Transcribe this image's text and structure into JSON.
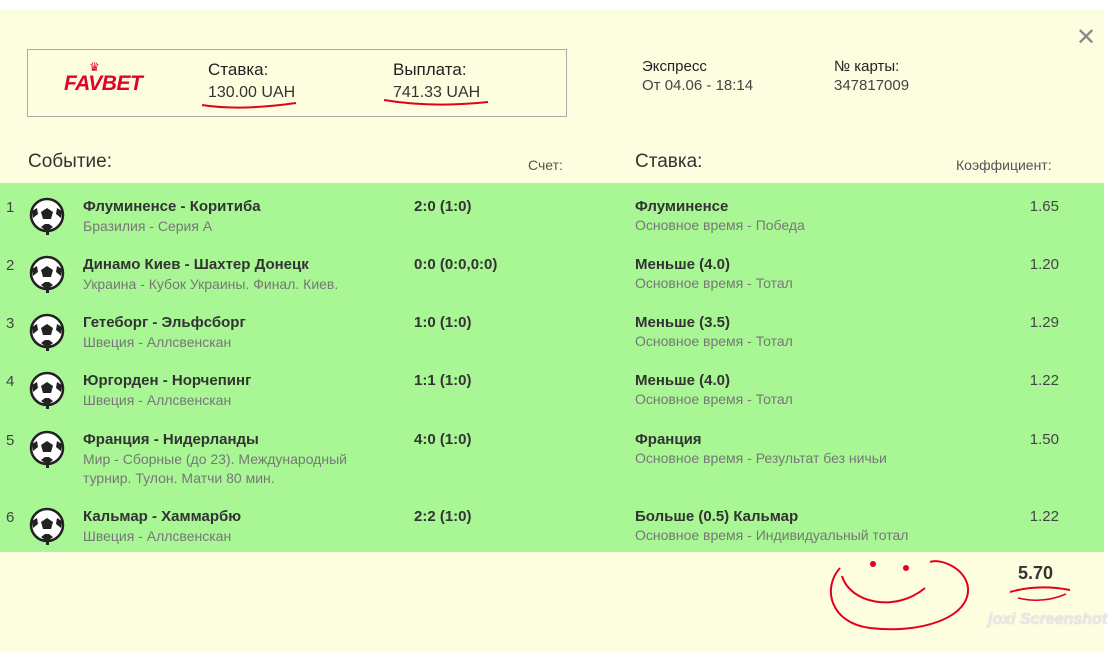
{
  "logo_text": "FAVBET",
  "summary": {
    "stake_label": "Ставка:",
    "stake_value": "130.00 UAH",
    "payout_label": "Выплата:",
    "payout_value": "741.33 UAH"
  },
  "info": {
    "type_label": "Экспресс",
    "date_text": "От 04.06 - 18:14",
    "card_label": "№ карты:",
    "card_number": "347817009"
  },
  "headers": {
    "event": "Событие:",
    "score": "Счет:",
    "bet": "Ставка:",
    "coef": "Коэффициент:"
  },
  "rows": [
    {
      "num": "1",
      "event": "Флуминенсе - Коритиба",
      "league": "Бразилия - Серия А",
      "score": "2:0 (1:0)",
      "bet": "Флуминенсе",
      "market": "Основное время - Победа",
      "coef": "1.65"
    },
    {
      "num": "2",
      "event": "Динамо Киев - Шахтер Донецк",
      "league": "Украина - Кубок Украины. Финал. Киев.",
      "score": "0:0 (0:0,0:0)",
      "bet": "Меньше (4.0)",
      "market": "Основное время - Тотал",
      "coef": "1.20"
    },
    {
      "num": "3",
      "event": "Гетеборг - Эльфсборг",
      "league": "Швеция - Аллсвенскан",
      "score": "1:0 (1:0)",
      "bet": "Меньше (3.5)",
      "market": "Основное время - Тотал",
      "coef": "1.29"
    },
    {
      "num": "4",
      "event": "Юргорден - Норчепинг",
      "league": "Швеция - Аллсвенскан",
      "score": "1:1 (1:0)",
      "bet": "Меньше (4.0)",
      "market": "Основное время - Тотал",
      "coef": "1.22"
    },
    {
      "num": "5",
      "event": "Франция - Нидерланды",
      "league": "Мир - Сборные (до 23). Международный турнир. Тулон. Матчи 80 мин.",
      "score": "4:0 (1:0)",
      "bet": "Франция",
      "market": "Основное время - Результат без ничьи",
      "coef": "1.50"
    },
    {
      "num": "6",
      "event": "Кальмар - Хаммарбю",
      "league": "Швеция - Аллсвенскан",
      "score": "2:2 (1:0)",
      "bet": "Больше (0.5) Кальмар",
      "market": "Основное время - Индивидуальный тотал",
      "coef": "1.22"
    }
  ],
  "total_coef": "5.70",
  "watermark": "joxi Screenshot",
  "colors": {
    "panel_bg": "#fdfddf",
    "rows_bg": "#a9f695",
    "logo_red": "#e3002a",
    "annotation_red": "#e5001a"
  },
  "icons": {
    "close": "close-icon",
    "sport": "soccer-ball-icon"
  }
}
